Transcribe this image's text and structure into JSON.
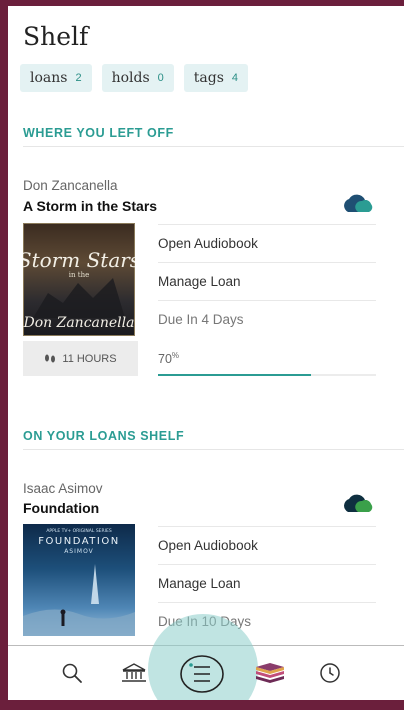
{
  "header": {
    "title": "Shelf"
  },
  "chips": [
    {
      "label": "loans",
      "count": "2"
    },
    {
      "label": "holds",
      "count": "0"
    },
    {
      "label": "tags",
      "count": "4"
    }
  ],
  "sections": {
    "left_off": "WHERE YOU LEFT OFF",
    "loans_shelf": "ON YOUR LOANS SHELF"
  },
  "book1": {
    "author": "Don Zancanella",
    "title": "A Storm in the Stars",
    "cover_title": "Storm Stars",
    "cover_sub": "in the",
    "cover_author": "Don Zancanella",
    "actions": [
      "Open Audiobook",
      "Manage Loan",
      "Due In 4 Days"
    ],
    "hours": "11 HOURS",
    "progress_label": "70",
    "progress_sup": "%",
    "progress": 0.7
  },
  "book2": {
    "author": "Isaac Asimov",
    "title": "Foundation",
    "cover_title": "FOUNDATION",
    "cover_author": "ASIMOV",
    "cover_top": "APPLE TV+ ORIGINAL SERIES",
    "actions": [
      "Open Audiobook",
      "Manage Loan",
      "Due In 10 Days"
    ]
  },
  "nav": [
    "search-icon",
    "library-icon",
    "menu-icon",
    "books-icon",
    "clock-icon"
  ],
  "colors": {
    "accent": "#2b9c93",
    "frame": "#6b1f3c",
    "chip_bg": "#e4f2f3"
  }
}
